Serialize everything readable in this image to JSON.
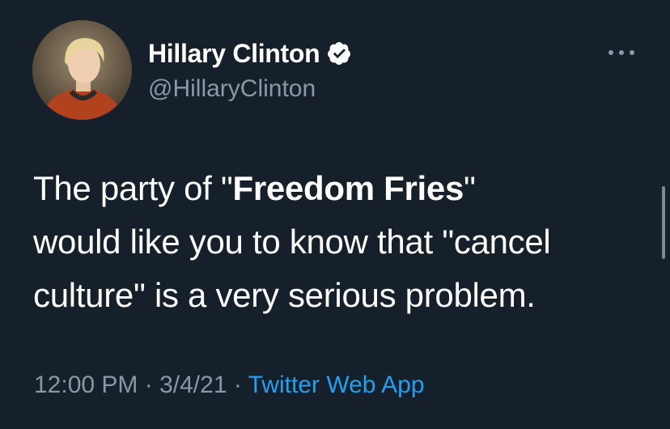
{
  "author": {
    "display_name": "Hillary Clinton",
    "handle": "@HillaryClinton",
    "verified": true
  },
  "tweet": {
    "line1_prefix": "The party of \"",
    "line1_bold": "Freedom Fries",
    "line1_suffix": "\"",
    "line2": "would like you to know that \"cancel",
    "line3": "culture\" is a very serious problem."
  },
  "meta": {
    "time": "12:00 PM",
    "separator1": " · ",
    "date": "3/4/21",
    "separator2": " · ",
    "source": "Twitter Web App"
  },
  "colors": {
    "background": "#15202b",
    "text": "#ffffff",
    "secondary": "#8899a6",
    "accent": "#1da1f2"
  },
  "icons": {
    "verified": "verified-badge-icon",
    "more": "more-options-icon"
  }
}
